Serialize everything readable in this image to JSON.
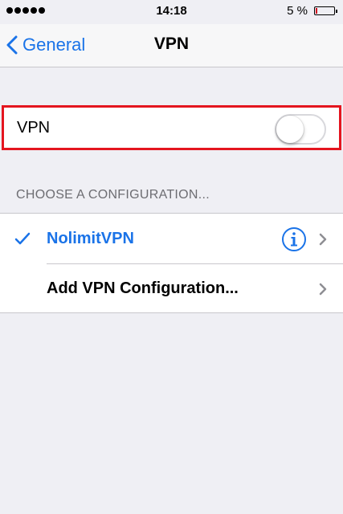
{
  "status_bar": {
    "time": "14:18",
    "battery_percent": "5 %",
    "battery_level": 0.05,
    "signal_dots": 5,
    "battery_color": "#d0021b"
  },
  "nav": {
    "back_label": "General",
    "title": "VPN"
  },
  "vpn_toggle": {
    "label": "VPN",
    "state": "off",
    "highlight_color": "#e4151f"
  },
  "configurations": {
    "section_header": "CHOOSE A CONFIGURATION...",
    "items": [
      {
        "name": "NolimitVPN",
        "selected": true,
        "icons": [
          "checkmark-icon",
          "info-icon",
          "chevron-right-icon"
        ]
      }
    ],
    "add_label": "Add VPN Configuration..."
  },
  "colors": {
    "accent": "#1a73e8",
    "background": "#efeff4",
    "separator": "#c8c7cc",
    "section_text": "#6d6d72"
  }
}
